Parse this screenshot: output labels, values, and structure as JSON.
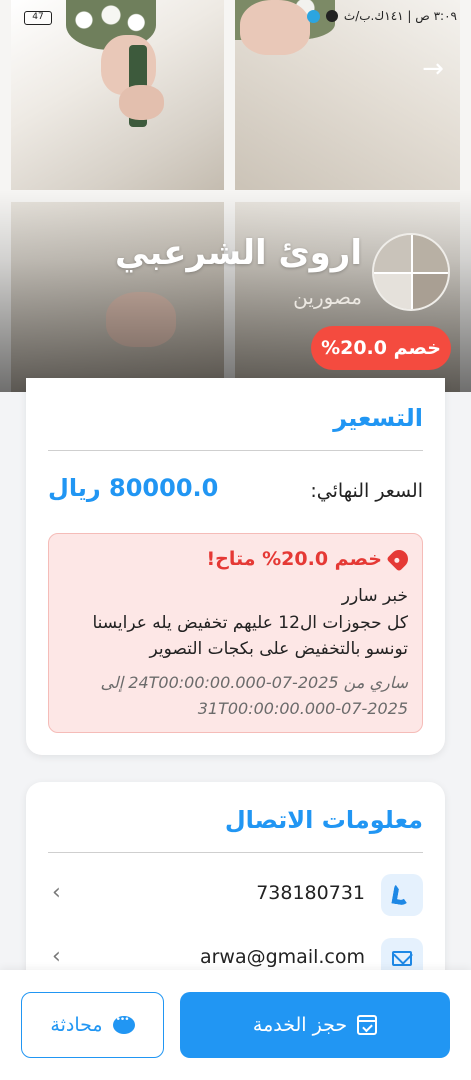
{
  "status_bar": {
    "battery": "47",
    "time_text": "٣:٠٩ ص | ١٤١ك.ب/ث"
  },
  "vendor": {
    "name": "اروئ الشرعبي",
    "category": "مصورين",
    "discount_badge": "خصم 20.0%"
  },
  "pricing": {
    "title": "التسعير",
    "final_price_label": "السعر النهائي:",
    "final_price_value": "80000.0 ريال",
    "offer": {
      "title": "خصم 20.0% متاح!",
      "subtitle": "خبر سارر",
      "description": "كل حجوزات ال12 عليهم تخفيض يله عرايسنا تونسو بالتخفيض على بكجات التصوير",
      "validity": "ساري من 2025-07-24T00:00:00.000 إلى 2025-07-31T00:00:00.000"
    }
  },
  "contact": {
    "title": "معلومات الاتصال",
    "phone": "738180731",
    "email": "arwa@gmail.com"
  },
  "actions": {
    "book_label": "حجز الخدمة",
    "chat_label": "محادثة"
  },
  "colors": {
    "primary": "#2196f3",
    "discount": "#f44b3f"
  }
}
